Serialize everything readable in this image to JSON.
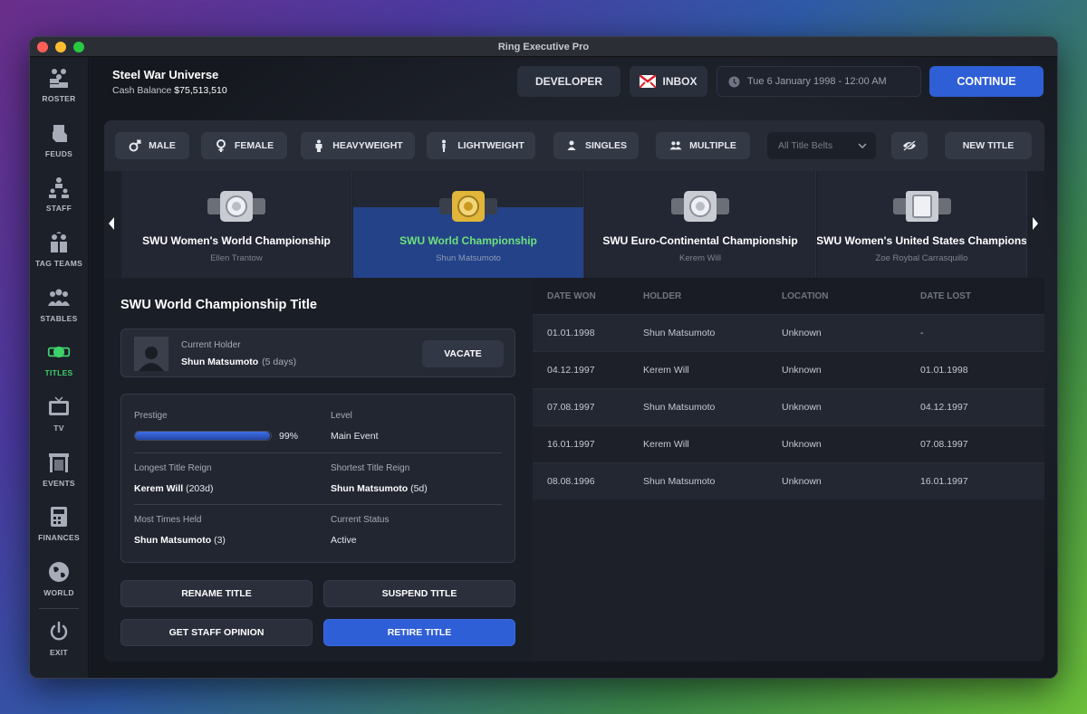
{
  "window": {
    "title": "Ring Executive Pro"
  },
  "sidebar": {
    "items": [
      {
        "label": "ROSTER",
        "icon": "roster-icon"
      },
      {
        "label": "FEUDS",
        "icon": "fist-icon"
      },
      {
        "label": "STAFF",
        "icon": "staff-icon"
      },
      {
        "label": "TAG TEAMS",
        "icon": "tag-team-icon"
      },
      {
        "label": "STABLES",
        "icon": "stables-icon"
      },
      {
        "label": "TITLES",
        "icon": "belt-icon",
        "active": true
      },
      {
        "label": "TV",
        "icon": "tv-icon"
      },
      {
        "label": "EVENTS",
        "icon": "events-icon"
      },
      {
        "label": "FINANCES",
        "icon": "finances-icon"
      },
      {
        "label": "WORLD",
        "icon": "globe-icon"
      }
    ],
    "exit": {
      "label": "EXIT",
      "icon": "power-icon"
    }
  },
  "header": {
    "company_name": "Steel War Universe",
    "cash_label": "Cash Balance",
    "cash_value": "$75,513,510",
    "developer_label": "DEVELOPER",
    "inbox_label": "INBOX",
    "date": "Tue 6 January 1998 - 12:00 AM",
    "continue_label": "CONTINUE"
  },
  "filters": {
    "male": "MALE",
    "female": "FEMALE",
    "heavyweight": "HEAVYWEIGHT",
    "lightweight": "LIGHTWEIGHT",
    "singles": "SINGLES",
    "multiple": "MULTIPLE",
    "select_value": "All Title Belts",
    "new_title": "NEW TITLE"
  },
  "belts": [
    {
      "name": "SWU Women's World Championship",
      "holder": "Ellen Trantow",
      "color": "#c9ccd2"
    },
    {
      "name": "SWU World Championship",
      "holder": "Shun Matsumoto",
      "color": "#e0b53a",
      "active": true
    },
    {
      "name": "SWU Euro-Continental Championship",
      "holder": "Kerem Will",
      "color": "#c9ccd2"
    },
    {
      "name": "SWU Women's United States Champions",
      "holder": "Zoe Roybal Carrasquillo",
      "color": "#c9ccd2"
    }
  ],
  "detail": {
    "title": "SWU World Championship Title",
    "current_holder_label": "Current Holder",
    "current_holder": "Shun Matsumoto",
    "current_holder_days": "(5 days)",
    "vacate_label": "VACATE",
    "prestige_label": "Prestige",
    "prestige_value": 99,
    "prestige_text": "99%",
    "level_label": "Level",
    "level_value": "Main Event",
    "longest_label": "Longest Title Reign",
    "longest_name": "Kerem Will",
    "longest_days": "(203d)",
    "shortest_label": "Shortest Title Reign",
    "shortest_name": "Shun Matsumoto",
    "shortest_days": "(5d)",
    "most_label": "Most Times Held",
    "most_name": "Shun Matsumoto",
    "most_count": "(3)",
    "status_label": "Current Status",
    "status_value": "Active",
    "rename": "RENAME TITLE",
    "suspend": "SUSPEND TITLE",
    "opinion": "GET STAFF OPINION",
    "retire": "RETIRE TITLE"
  },
  "history": {
    "columns": [
      "DATE WON",
      "HOLDER",
      "LOCATION",
      "DATE LOST"
    ],
    "rows": [
      [
        "01.01.1998",
        "Shun Matsumoto",
        "Unknown",
        "-"
      ],
      [
        "04.12.1997",
        "Kerem Will",
        "Unknown",
        "01.01.1998"
      ],
      [
        "07.08.1997",
        "Shun Matsumoto",
        "Unknown",
        "04.12.1997"
      ],
      [
        "16.01.1997",
        "Kerem Will",
        "Unknown",
        "07.08.1997"
      ],
      [
        "08.08.1996",
        "Shun Matsumoto",
        "Unknown",
        "16.01.1997"
      ]
    ]
  },
  "colors": {
    "accent": "#2f5fd6",
    "active_green": "#3fd16b"
  }
}
